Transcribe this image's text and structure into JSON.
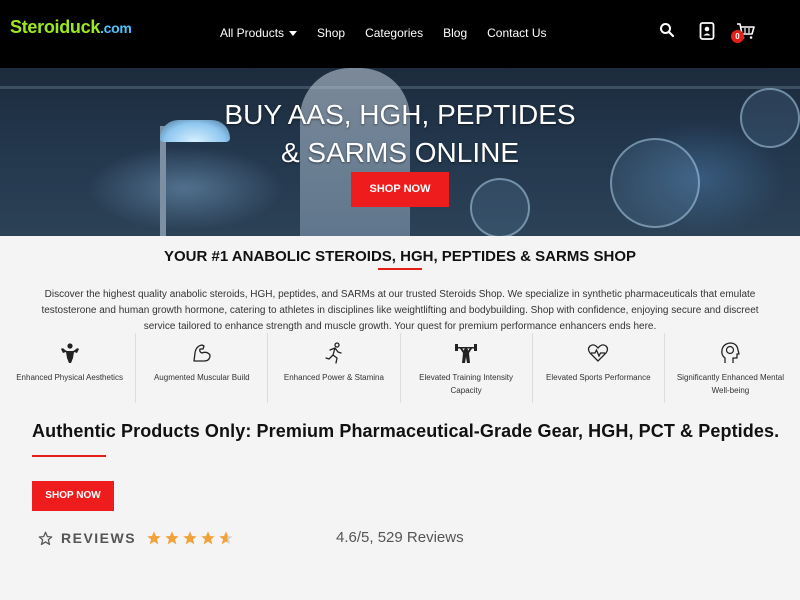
{
  "header": {
    "logo_main": "Steroiduck",
    "logo_tld": ".com",
    "nav": [
      {
        "label": "All Products",
        "has_dropdown": true
      },
      {
        "label": "Shop"
      },
      {
        "label": "Categories"
      },
      {
        "label": "Blog"
      },
      {
        "label": "Contact Us"
      }
    ],
    "icons": [
      "search-icon",
      "account-icon",
      "cart-icon"
    ],
    "cart_count": "0"
  },
  "hero": {
    "title_line1": "BUY AAS, HGH, PEPTIDES",
    "title_line2": "& SARMS ONLINE",
    "button_label": "SHOP NOW"
  },
  "intro": {
    "title": "YOUR #1 ANABOLIC STEROIDS, HGH, PEPTIDES & SARMS SHOP",
    "text": "Discover the highest quality anabolic steroids, HGH, peptides, and SARMs at our trusted Steroids Shop. We specialize in synthetic pharmaceuticals that emulate testosterone and human growth hormone, catering to athletes in disciplines like weightlifting and bodybuilding. Shop with confidence, enjoying secure and discreet service tailored to enhance strength and muscle growth. Your quest for premium performance enhancers ends here."
  },
  "features": [
    {
      "label": "Enhanced Physical Aesthetics",
      "icon": "bodybuilder-icon"
    },
    {
      "label": "Augmented Muscular Build",
      "icon": "flexed-arm-icon"
    },
    {
      "label": "Enhanced Power & Stamina",
      "icon": "runner-icon"
    },
    {
      "label": "Elevated Training Intensity Capacity",
      "icon": "weightlifter-icon"
    },
    {
      "label": "Elevated Sports Performance",
      "icon": "heart-pulse-icon"
    },
    {
      "label": "Significantly Enhanced Mental Well-being",
      "icon": "brain-head-icon"
    }
  ],
  "authentic": {
    "title": "Authentic Products Only: Premium Pharmaceutical-Grade Gear, HGH, PCT & Peptides.",
    "button_label": "SHOP NOW"
  },
  "reviews": {
    "label": "REVIEWS",
    "rating": 4.6,
    "rating_text": "4.6/5, 529 Reviews"
  },
  "colors": {
    "accent": "#ee1c1c",
    "header_bg": "#000000",
    "logo_green": "#9be81e",
    "logo_blue": "#4cc3ff",
    "star": "#f2a23a"
  }
}
